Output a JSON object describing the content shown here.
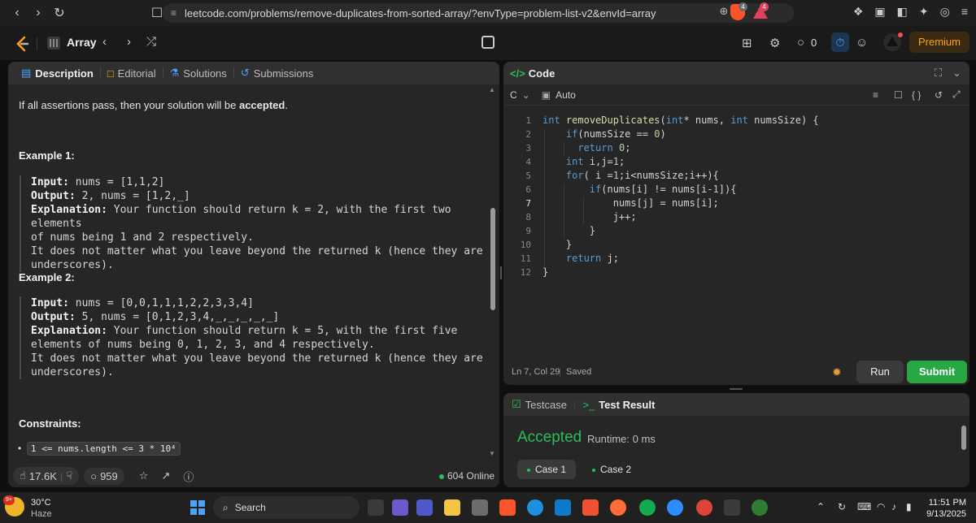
{
  "browser": {
    "url": "leetcode.com/problems/remove-duplicates-from-sorted-array/?envType=problem-list-v2&envId=array",
    "shield_badge": "4",
    "reward_badge": "4"
  },
  "nav": {
    "list_title": "Array",
    "streak_count": "0",
    "premium_label": "Premium"
  },
  "description": {
    "tabs": [
      {
        "label": "Description"
      },
      {
        "label": "Editorial"
      },
      {
        "label": "Solutions"
      },
      {
        "label": "Submissions"
      }
    ],
    "assertion_line_prefix": "If all assertions pass, then your solution will be ",
    "assertion_line_bold": "accepted",
    "assertion_line_suffix": ".",
    "example1": {
      "title": "Example 1:",
      "input_label": "Input:",
      "input_value": " nums = [1,1,2]",
      "output_label": "Output:",
      "output_value": " 2, nums = [1,2,_]",
      "explanation_label": "Explanation:",
      "explanation_value": " Your function should return k = 2, with the first two elements",
      "explanation_line2": "of nums being 1 and 2 respectively.",
      "explanation_line3": "It does not matter what you leave beyond the returned k (hence they are",
      "explanation_line4": "underscores)."
    },
    "example2": {
      "title": "Example 2:",
      "input_label": "Input:",
      "input_value": " nums = [0,0,1,1,1,2,2,3,3,4]",
      "output_label": "Output:",
      "output_value": " 5, nums = [0,1,2,3,4,_,_,_,_,_]",
      "explanation_label": "Explanation:",
      "explanation_value": " Your function should return k = 5, with the first five",
      "explanation_line2": "elements of nums being 0, 1, 2, 3, and 4 respectively.",
      "explanation_line3": "It does not matter what you leave beyond the returned k (hence they are",
      "explanation_line4": "underscores)."
    },
    "constraints_title": "Constraints:",
    "constraint1": "1 <= nums.length <= 3 * 10⁴",
    "likes": "17.6K",
    "comments": "959",
    "online": "604 Online"
  },
  "code": {
    "header": "Code",
    "language": "C",
    "mode": "Auto",
    "line_numbers": [
      "1",
      "2",
      "3",
      "4",
      "5",
      "6",
      "7",
      "8",
      "9",
      "10",
      "11",
      "12"
    ],
    "status_position": "Ln 7, Col 29",
    "status_saved": "Saved",
    "run_label": "Run",
    "submit_label": "Submit"
  },
  "result": {
    "tab_testcase": "Testcase",
    "tab_test_result": "Test Result",
    "verdict": "Accepted",
    "runtime": "Runtime: 0 ms",
    "cases": [
      {
        "label": "Case 1"
      },
      {
        "label": "Case 2"
      }
    ]
  },
  "taskbar": {
    "temperature": "30°C",
    "weather": "Haze",
    "weather_badge": "9+",
    "search_label": "Search",
    "time": "11:51 PM",
    "date": "9/13/2025"
  }
}
